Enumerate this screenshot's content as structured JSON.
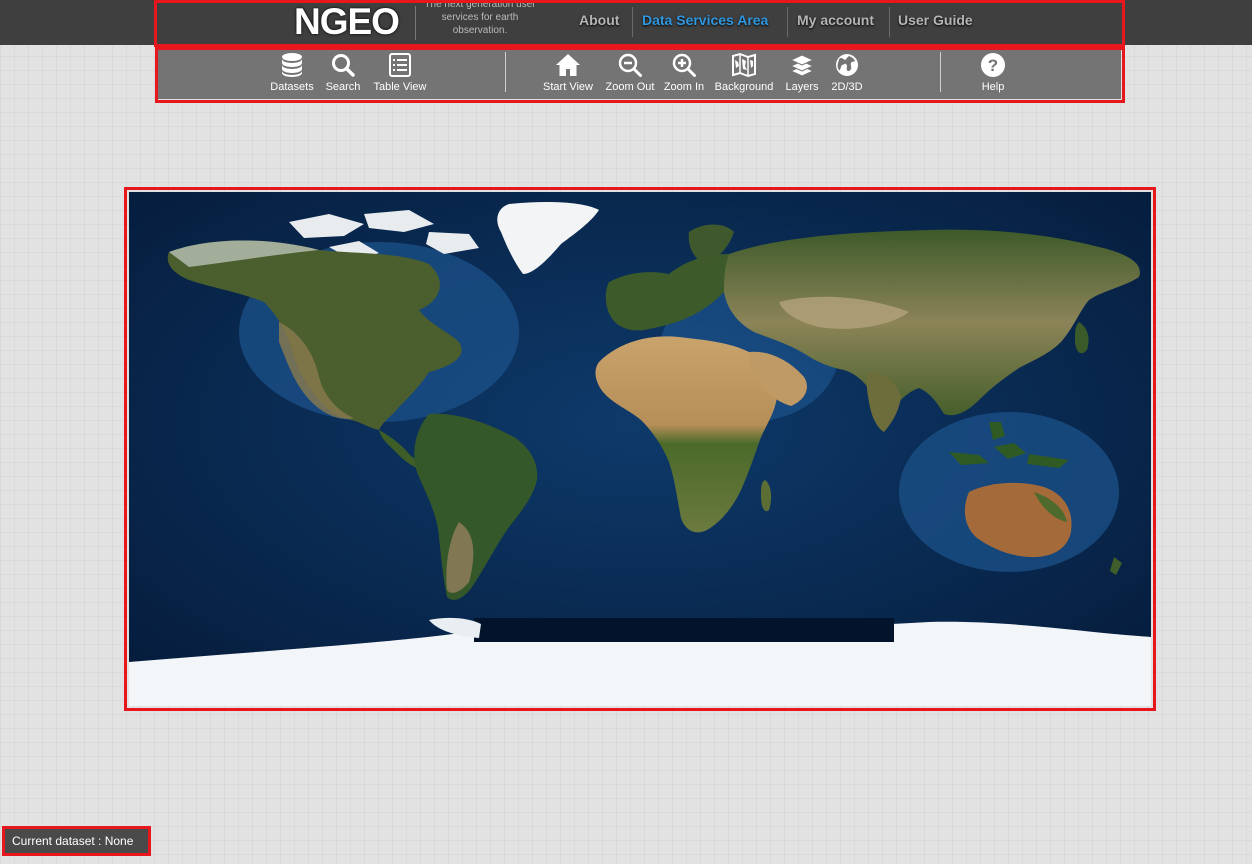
{
  "header": {
    "logo": "NGEO",
    "tagline": "The next generation user services for earth observation.",
    "nav": [
      {
        "label": "About",
        "active": false
      },
      {
        "label": "Data Services Area",
        "active": true
      },
      {
        "label": "My account",
        "active": false
      },
      {
        "label": "User Guide",
        "active": false
      }
    ],
    "active_color": "#2e97e0"
  },
  "toolbar": {
    "items": [
      {
        "label": "Datasets",
        "icon": "database-icon"
      },
      {
        "label": "Search",
        "icon": "search-icon"
      },
      {
        "label": "Table View",
        "icon": "table-view-icon"
      },
      {
        "label": "Start View",
        "icon": "home-icon"
      },
      {
        "label": "Zoom Out",
        "icon": "zoom-out-icon"
      },
      {
        "label": "Zoom In",
        "icon": "zoom-in-icon"
      },
      {
        "label": "Background",
        "icon": "map-icon"
      },
      {
        "label": "Layers",
        "icon": "layers-icon"
      },
      {
        "label": "2D/3D",
        "icon": "globe-icon"
      },
      {
        "label": "Help",
        "icon": "help-icon"
      }
    ]
  },
  "map": {
    "content": "world-map-blue-marble"
  },
  "status": {
    "current_dataset": "Current dataset : None"
  },
  "highlight_color": "#e8161d"
}
